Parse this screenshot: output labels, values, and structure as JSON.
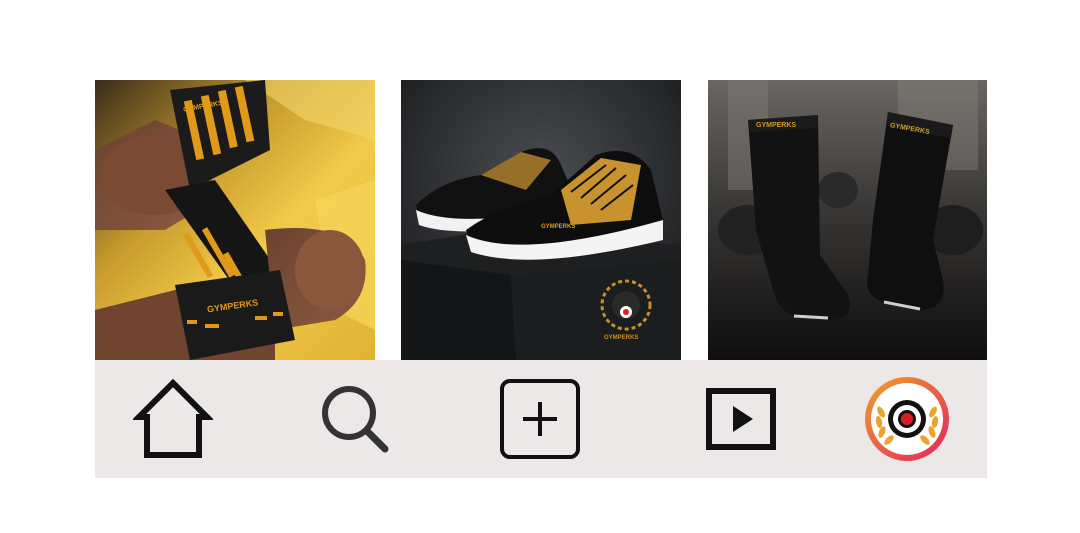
{
  "feed": {
    "posts": [
      {
        "subject": "wrist wraps",
        "brand_text": "GYMPERKS"
      },
      {
        "subject": "sneakers on shoe box",
        "brand_text": "GYMPERKS"
      },
      {
        "subject": "crew socks",
        "brand_text": "GYMPERKS"
      }
    ]
  },
  "nav": {
    "items": [
      {
        "icon": "home-icon"
      },
      {
        "icon": "search-icon"
      },
      {
        "icon": "plus-square-icon"
      },
      {
        "icon": "play-square-icon"
      },
      {
        "icon": "profile-avatar"
      }
    ]
  },
  "colors": {
    "accent_gold": "#e09a1a",
    "navbar_bg": "#ebe8e7",
    "icon": "#111111",
    "avatar_ring_start": "#f0a12a",
    "avatar_ring_end": "#e0245e",
    "avatar_target": "#d81e1e"
  }
}
